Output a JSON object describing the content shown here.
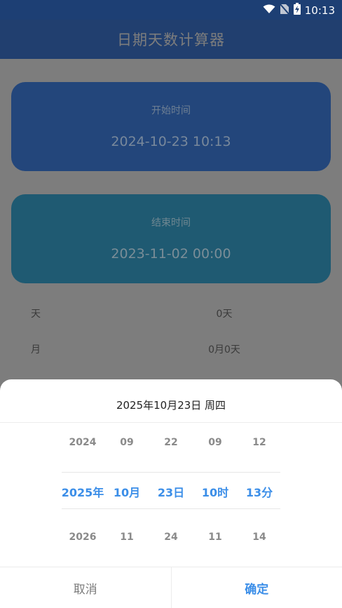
{
  "status_bar": {
    "time": "10:13",
    "icons": [
      "wifi-icon",
      "no-sim-icon",
      "battery-charging-icon"
    ]
  },
  "app": {
    "title": "日期天数计算器"
  },
  "start_card": {
    "label": "开始时间",
    "value": "2024-10-23 10:13"
  },
  "end_card": {
    "label": "结束时间",
    "value": "2023-11-02 00:00"
  },
  "results": [
    {
      "key": "天",
      "value": "0天"
    },
    {
      "key": "月",
      "value": "0月0天"
    }
  ],
  "picker": {
    "header": "2025年10月23日 周四",
    "columns": [
      {
        "prev": "2024",
        "current": "2025年",
        "next": "2026"
      },
      {
        "prev": "09",
        "current": "10月",
        "next": "11"
      },
      {
        "prev": "22",
        "current": "23日",
        "next": "24"
      },
      {
        "prev": "09",
        "current": "10时",
        "next": "11"
      },
      {
        "prev": "12",
        "current": "13分",
        "next": "14"
      }
    ],
    "cancel_label": "取消",
    "confirm_label": "确定"
  },
  "colors": {
    "accent": "#3b8ee8",
    "appbar": "#213f6f",
    "start_card": "#23467b",
    "end_card": "#1f5a72"
  }
}
